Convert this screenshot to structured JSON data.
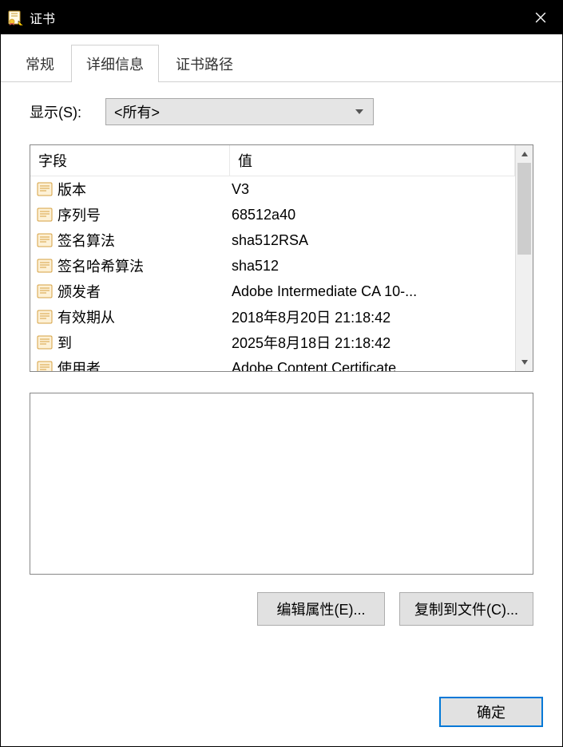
{
  "title": "证书",
  "tabs": [
    {
      "label": "常规",
      "active": false
    },
    {
      "label": "详细信息",
      "active": true
    },
    {
      "label": "证书路径",
      "active": false
    }
  ],
  "filter": {
    "label": "显示(S):",
    "selected": "<所有>"
  },
  "columns": {
    "field": "字段",
    "value": "值"
  },
  "rows": [
    {
      "field": "版本",
      "value": "V3"
    },
    {
      "field": "序列号",
      "value": "68512a40"
    },
    {
      "field": "签名算法",
      "value": "sha512RSA"
    },
    {
      "field": "签名哈希算法",
      "value": "sha512"
    },
    {
      "field": "颁发者",
      "value": "Adobe Intermediate CA 10-..."
    },
    {
      "field": "有效期从",
      "value": "2018年8月20日 21:18:42"
    },
    {
      "field": "到",
      "value": "2025年8月18日 21:18:42"
    },
    {
      "field": "使用者",
      "value": "Adobe Content Certificate ..."
    }
  ],
  "buttons": {
    "edit": "编辑属性(E)...",
    "copy": "复制到文件(C)...",
    "ok": "确定"
  }
}
